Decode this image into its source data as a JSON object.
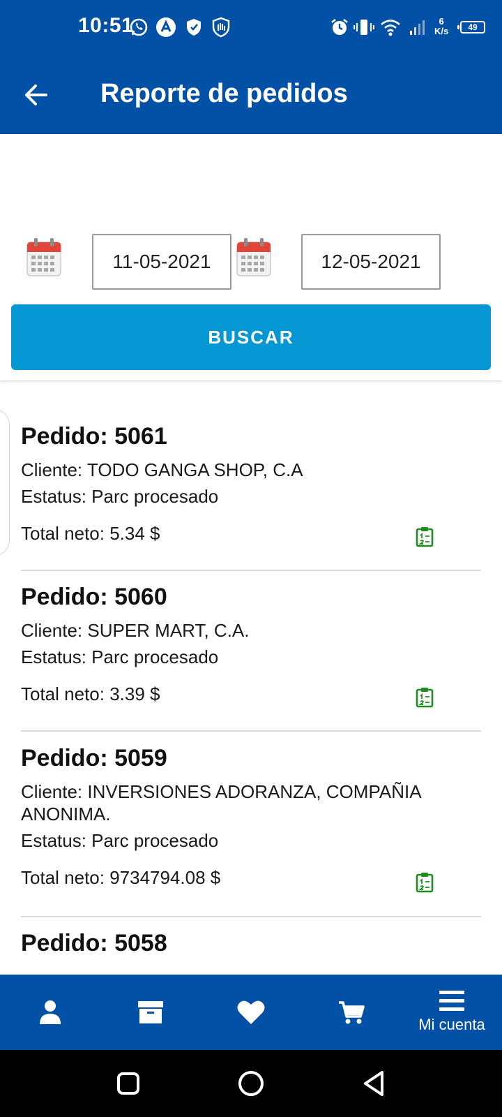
{
  "status_bar": {
    "time": "10:51",
    "network_speed_value": "6",
    "network_speed_unit": "K/s",
    "battery": "49"
  },
  "app_bar": {
    "title": "Reporte de pedidos"
  },
  "filters": {
    "date_from": "11-05-2021",
    "date_to": "12-05-2021",
    "search_label": "BUSCAR"
  },
  "orders": [
    {
      "title": "Pedido: 5061",
      "client": "Cliente: TODO GANGA SHOP, C.A",
      "status": "Estatus: Parc procesado",
      "total": "Total neto: 5.34 $"
    },
    {
      "title": "Pedido: 5060",
      "client": "Cliente: SUPER MART, C.A.",
      "status": "Estatus: Parc procesado",
      "total": "Total neto: 3.39 $"
    },
    {
      "title": "Pedido: 5059",
      "client": "Cliente: INVERSIONES ADORANZA, COMPAÑIA ANONIMA.",
      "status": "Estatus: Parc procesado",
      "total": "Total neto: 9734794.08 $"
    },
    {
      "title": "Pedido: 5058"
    }
  ],
  "bottom_nav": {
    "account_label": "Mi cuenta"
  },
  "colors": {
    "primary": "#0351a6",
    "button": "#0596d4",
    "detail_icon": "#1e8c1e",
    "calendar_red": "#e0453a"
  }
}
